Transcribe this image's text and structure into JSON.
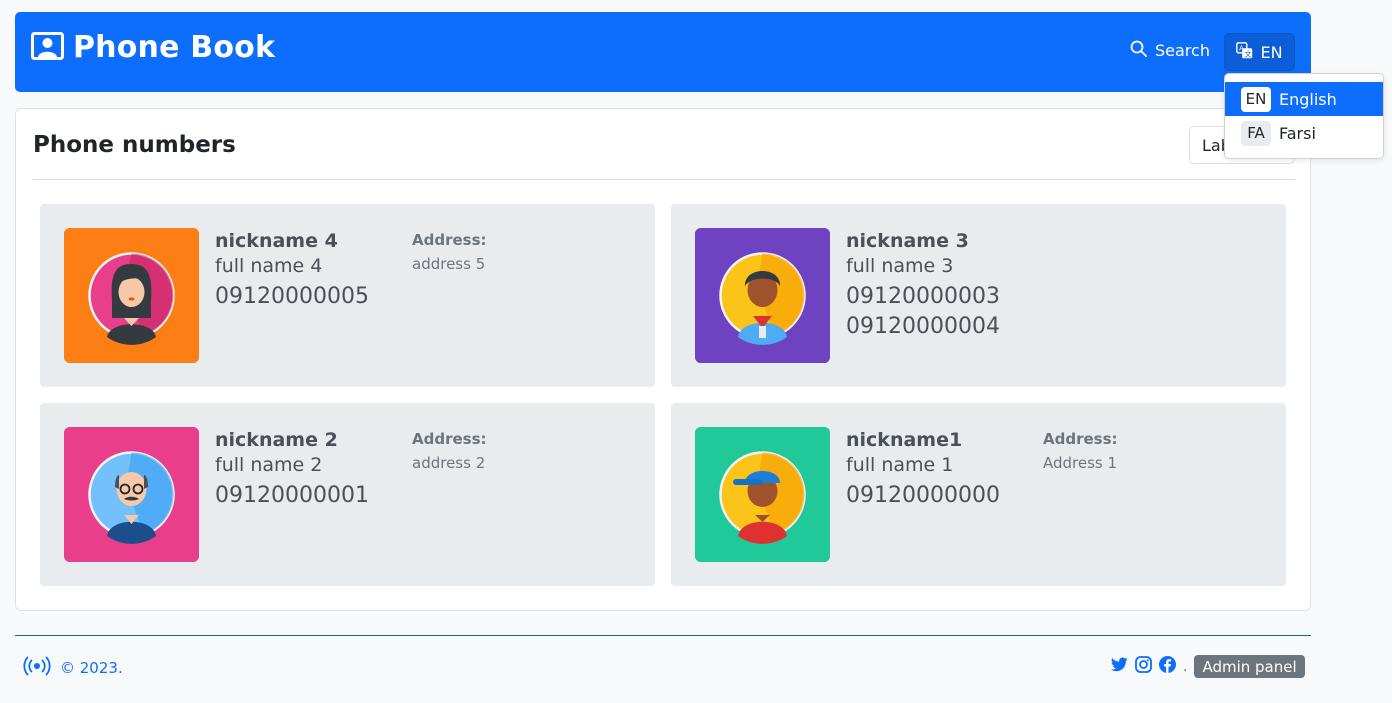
{
  "navbar": {
    "brand": "Phone Book",
    "search_label": "Search",
    "language_button": "EN"
  },
  "language_menu": [
    {
      "code": "EN",
      "label": "English",
      "active": true
    },
    {
      "code": "FA",
      "label": "Farsi",
      "active": false
    }
  ],
  "card": {
    "title": "Phone numbers",
    "label_button": "Lab"
  },
  "contacts": [
    {
      "nickname": "nickname 4",
      "full_name": "full name 4",
      "phones": [
        "09120000005"
      ],
      "address_label": "Address:",
      "address": "address 5",
      "avatar_bg": "#fd7e14",
      "avatar_icon": "woman-avatar-icon"
    },
    {
      "nickname": "nickname 3",
      "full_name": "full name 3",
      "phones": [
        "09120000003",
        "09120000004"
      ],
      "address_label": "",
      "address": "",
      "avatar_bg": "#6f42c1",
      "avatar_icon": "boy-avatar-icon"
    },
    {
      "nickname": "nickname 2",
      "full_name": "full name 2",
      "phones": [
        "09120000001"
      ],
      "address_label": "Address:",
      "address": "address 2",
      "avatar_bg": "#e83e8c",
      "avatar_icon": "old-man-avatar-icon"
    },
    {
      "nickname": "nickname1",
      "full_name": "full name 1",
      "phones": [
        "09120000000"
      ],
      "address_label": "Address:",
      "address": "Address 1",
      "avatar_bg": "#20c997",
      "avatar_icon": "cap-boy-avatar-icon"
    }
  ],
  "footer": {
    "copyright": "© 2023.",
    "separator": ".",
    "admin_label": "Admin panel"
  },
  "colors": {
    "primary": "#0d6efd",
    "card_bg": "#e9ecef",
    "secondary": "#6c757d"
  }
}
